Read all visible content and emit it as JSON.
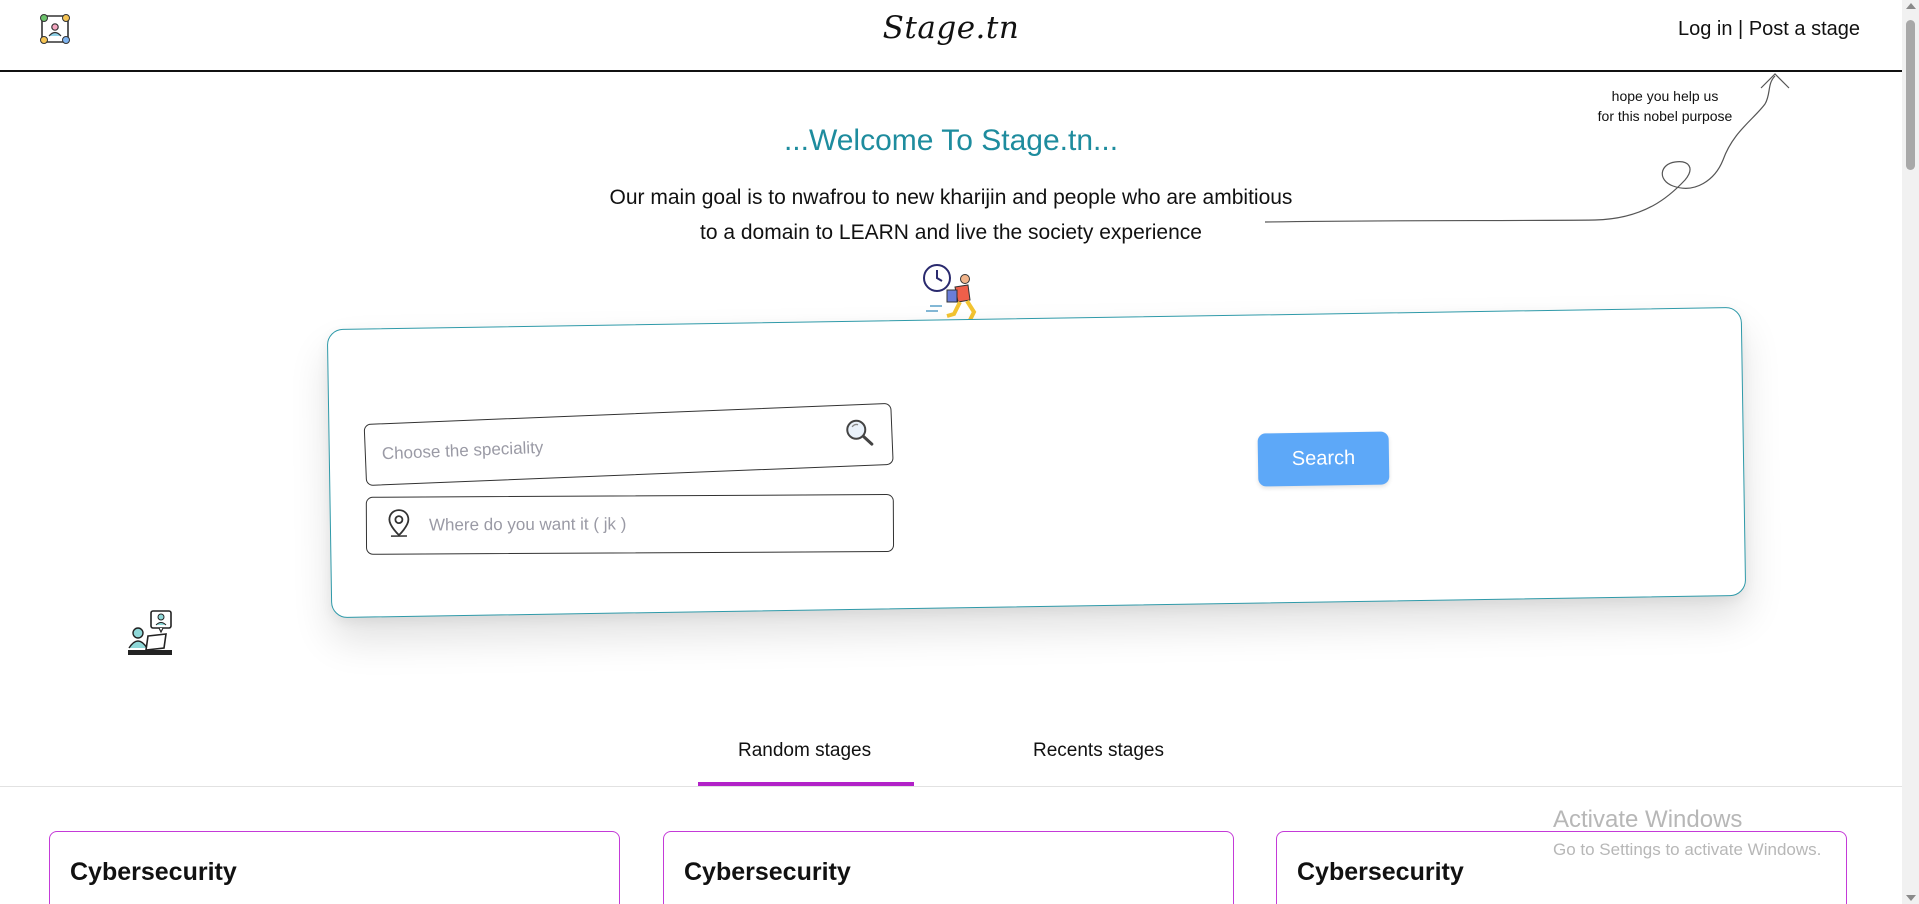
{
  "header": {
    "brand": "Stage.tn",
    "login_label": "Log in",
    "separator": " | ",
    "post_label": "Post a stage",
    "logo_icon": "team-network-icon"
  },
  "hero": {
    "welcome": "...Welcome To Stage.tn...",
    "goal_line1": "Our main goal is to nwafrou to new kharijin and people who are ambitious",
    "goal_line2": "to a domain to LEARN and live the society experience",
    "note_line1": "hope you help us",
    "note_line2": "for this nobel purpose",
    "runner_icon": "running-late-clock-icon",
    "study_icon": "online-learning-icon"
  },
  "search": {
    "speciality_placeholder": "Choose the speciality",
    "location_placeholder": "Where do you want it ( jk )",
    "button_label": "Search",
    "accent": "#2f9aa9",
    "button_color": "#5da8f8"
  },
  "tabs": {
    "items": [
      {
        "label": "Random stages",
        "active": true
      },
      {
        "label": "Recents stages",
        "active": false
      }
    ],
    "indicator_color": "#b221c8"
  },
  "results": [
    {
      "title": "Cybersecurity"
    },
    {
      "title": "Cybersecurity"
    },
    {
      "title": "Cybersecurity"
    }
  ],
  "watermark": {
    "line1": "Activate Windows",
    "line2": "Go to Settings to activate Windows."
  },
  "colors": {
    "welcome": "#1e8c9e",
    "card_border": "#c43ad8"
  }
}
